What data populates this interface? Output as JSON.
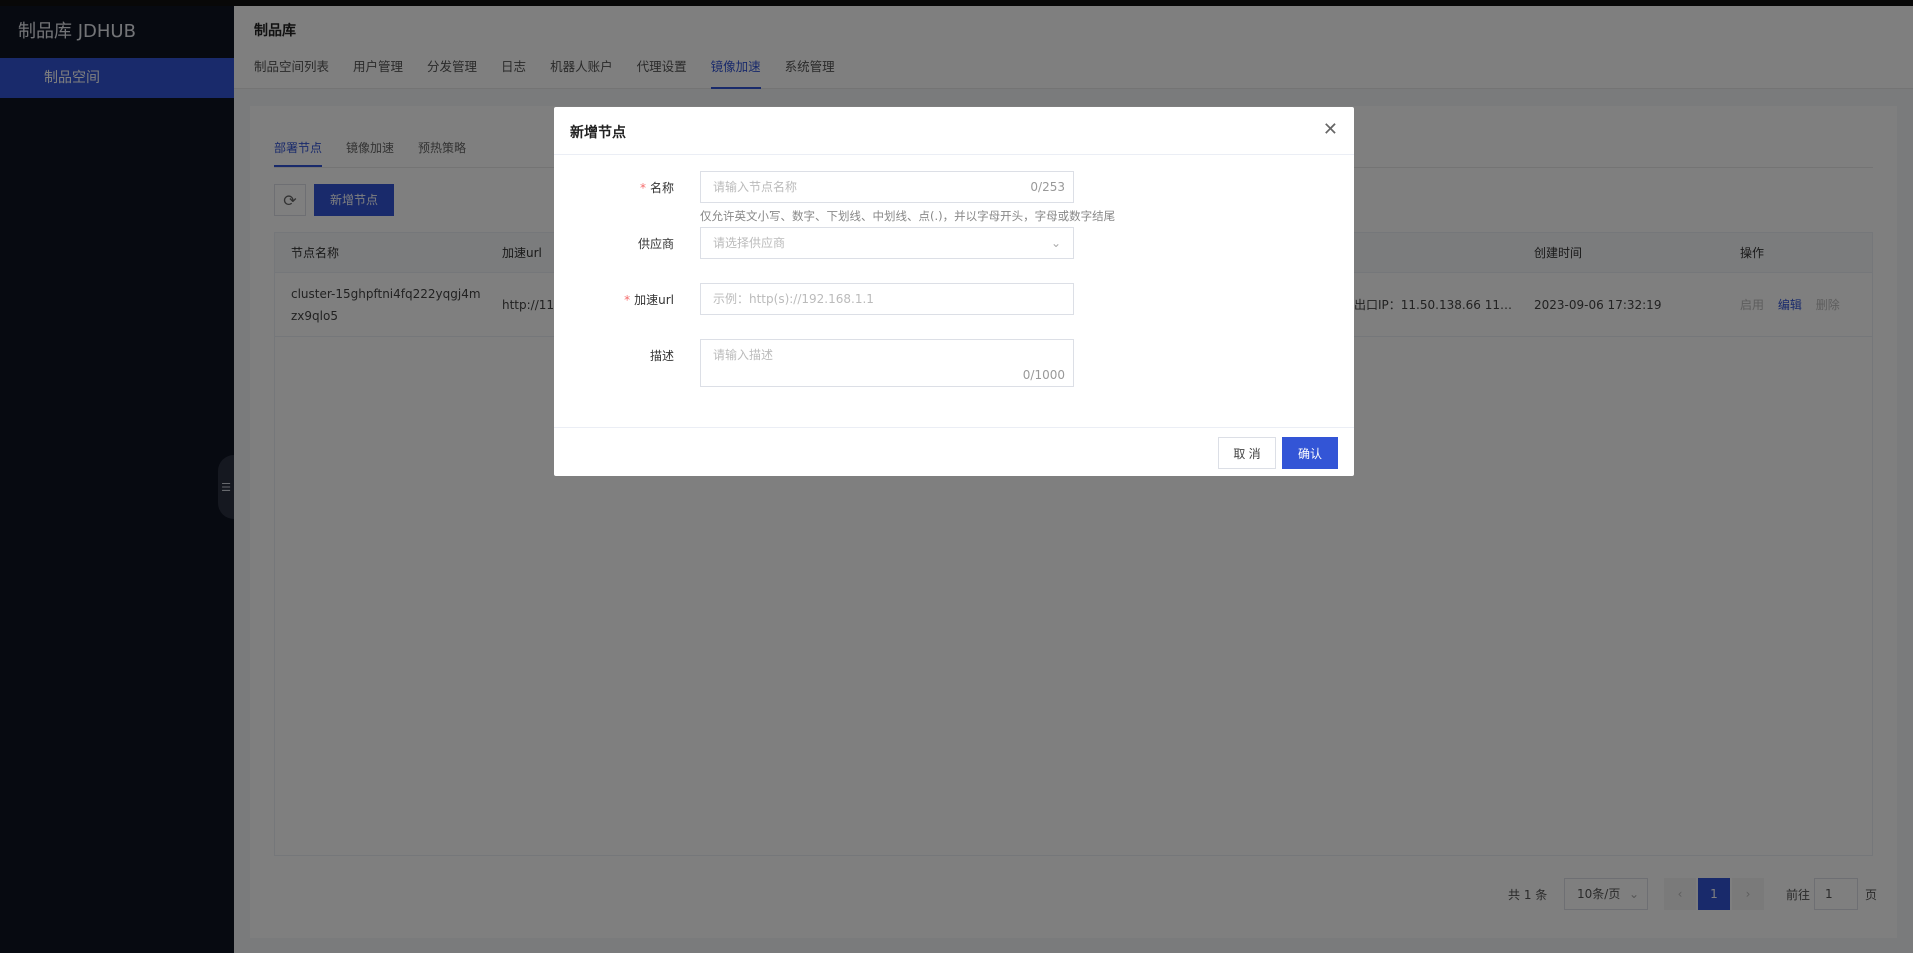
{
  "sidebar": {
    "brand": "制品库 JDHUB",
    "items": [
      {
        "label": "制品空间"
      }
    ]
  },
  "header": {
    "title": "制品库",
    "tabs": [
      {
        "label": "制品空间列表"
      },
      {
        "label": "用户管理"
      },
      {
        "label": "分发管理"
      },
      {
        "label": "日志"
      },
      {
        "label": "机器人账户"
      },
      {
        "label": "代理设置"
      },
      {
        "label": "镜像加速"
      },
      {
        "label": "系统管理"
      }
    ]
  },
  "subtabs": [
    {
      "label": "部署节点"
    },
    {
      "label": "镜像加速"
    },
    {
      "label": "预热策略"
    }
  ],
  "toolbar": {
    "add_label": "新增节点"
  },
  "table": {
    "columns": {
      "name": "节点名称",
      "url": "加速url",
      "created": "创建时间",
      "ops": "操作"
    },
    "rows": [
      {
        "name": "cluster-15ghpftni4fq222yqgj4mzx9qlo5",
        "url": "http://11.5",
        "egress": "出口IP：11.50.138.66 11.5...",
        "created": "2023-09-06 17:32:19",
        "ops": {
          "enable": "启用",
          "edit": "编辑",
          "delete": "删除"
        }
      }
    ]
  },
  "pagination": {
    "total": "共 1 条",
    "page_size": "10条/页",
    "current_page": "1",
    "goto_prefix": "前往",
    "goto_value": "1",
    "goto_suffix": "页"
  },
  "dialog": {
    "title": "新增节点",
    "fields": {
      "name": {
        "label": "名称",
        "placeholder": "请输入节点名称",
        "counter": "0/253",
        "hint": "仅允许英文小写、数字、下划线、中划线、点(.)，并以字母开头，字母或数字结尾"
      },
      "provider": {
        "label": "供应商",
        "placeholder": "请选择供应商"
      },
      "url": {
        "label": "加速url",
        "placeholder": "示例：http(s)://192.168.1.1"
      },
      "description": {
        "label": "描述",
        "placeholder": "请输入描述",
        "counter": "0/1000"
      }
    },
    "cancel_label": "取 消",
    "ok_label": "确认"
  }
}
